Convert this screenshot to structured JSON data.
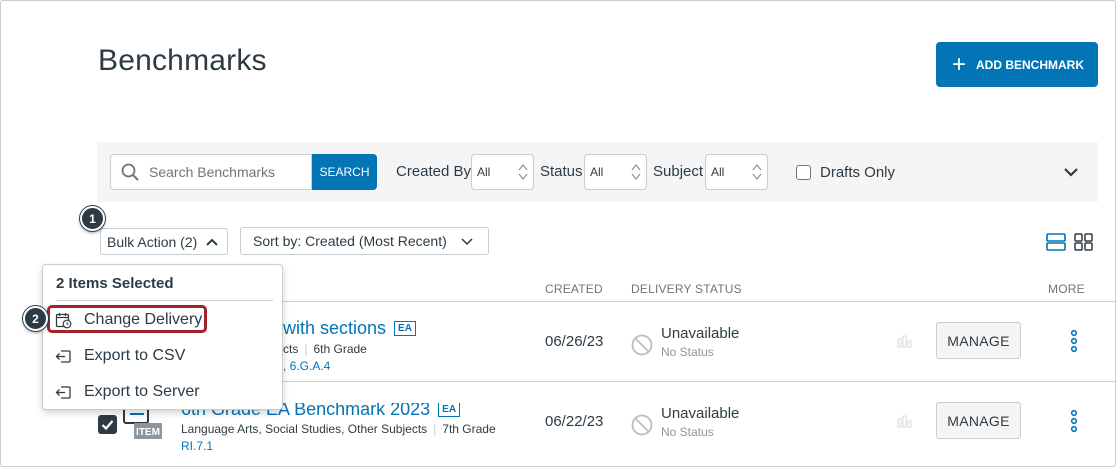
{
  "page": {
    "title": "Benchmarks",
    "add_button": "ADD BENCHMARK"
  },
  "filters": {
    "search_placeholder": "Search Benchmarks",
    "search_button": "SEARCH",
    "created_by_label": "Created By",
    "created_by_value": "All",
    "status_label": "Status",
    "status_value": "All",
    "subject_label": "Subject",
    "subject_value": "All",
    "drafts_only": "Drafts Only"
  },
  "toolbar": {
    "bulk_action": "Bulk Action (2)",
    "sort_prefix": "Sort by:",
    "sort_value": "Created (Most Recent)"
  },
  "columns": {
    "created": "CREATED",
    "delivery_status": "DELIVERY STATUS",
    "more": "MORE"
  },
  "rows": [
    {
      "title": "with sections",
      "badge": "EA",
      "subjects": "cts",
      "grade": "6th Grade",
      "standards": ", 6.G.A.4",
      "created": "06/26/23",
      "status": "Unavailable",
      "substatus": "No Status",
      "manage": "MANAGE"
    },
    {
      "title": "6th Grade EA Benchmark 2023",
      "badge": "EA",
      "subjects": "Language Arts, Social Studies, Other Subjects",
      "grade": "7th Grade",
      "standards": "RI.7.1",
      "created": "06/22/23",
      "status": "Unavailable",
      "substatus": "No Status",
      "manage": "MANAGE"
    }
  ],
  "dropdown": {
    "title": "2 Items Selected",
    "items": [
      {
        "label": "Change Delivery",
        "icon": "calendar-clock-icon"
      },
      {
        "label": "Export to CSV",
        "icon": "export-icon"
      },
      {
        "label": "Export to Server",
        "icon": "export-icon"
      }
    ]
  },
  "steps": [
    "1",
    "2"
  ],
  "colors": {
    "accent": "#0374b5",
    "highlight": "#a4202b",
    "text": "#2d3b45"
  }
}
